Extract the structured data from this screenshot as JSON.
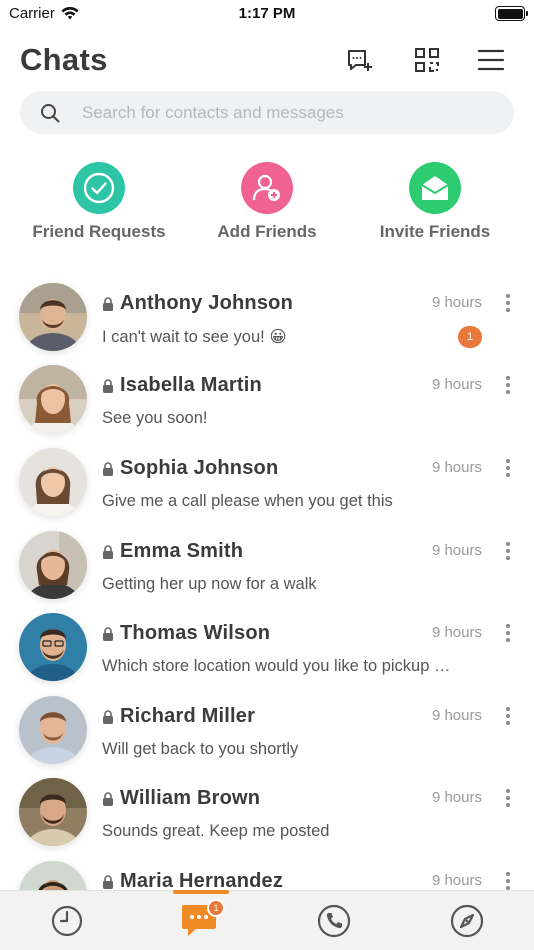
{
  "status_bar": {
    "carrier": "Carrier",
    "time": "1:17 PM"
  },
  "header": {
    "title": "Chats"
  },
  "search": {
    "placeholder": "Search for contacts and messages"
  },
  "quick_actions": [
    {
      "label": "Friend Requests",
      "color": "#2ec4a6",
      "icon": "check-circle-icon"
    },
    {
      "label": "Add Friends",
      "color": "#f06292",
      "icon": "add-user-icon"
    },
    {
      "label": "Invite Friends",
      "color": "#2ecc71",
      "icon": "open-envelope-icon"
    }
  ],
  "chats": [
    {
      "name": "Anthony Johnson",
      "message": "I can't wait to see you! 😀",
      "time": "9 hours",
      "unread": "1"
    },
    {
      "name": "Isabella Martin",
      "message": "See you soon!",
      "time": "9 hours"
    },
    {
      "name": "Sophia Johnson",
      "message": "Give me a call please when you get this",
      "time": "9 hours"
    },
    {
      "name": "Emma Smith",
      "message": "Getting her up now for a walk",
      "time": "9 hours"
    },
    {
      "name": "Thomas Wilson",
      "message": "Which store location would you like to pickup …",
      "time": "9 hours"
    },
    {
      "name": "Richard Miller",
      "message": "Will get back to you shortly",
      "time": "9 hours"
    },
    {
      "name": "William Brown",
      "message": "Sounds great. Keep me posted",
      "time": "9 hours"
    },
    {
      "name": "Maria Hernandez",
      "message": "",
      "time": "9 hours"
    }
  ],
  "tab_bar": {
    "tabs": [
      "history-icon",
      "chat-bubble-icon",
      "phone-icon",
      "compass-icon"
    ],
    "active_tab": "chat-bubble-icon",
    "chat_badge": "1",
    "accent": "#f08a24"
  }
}
